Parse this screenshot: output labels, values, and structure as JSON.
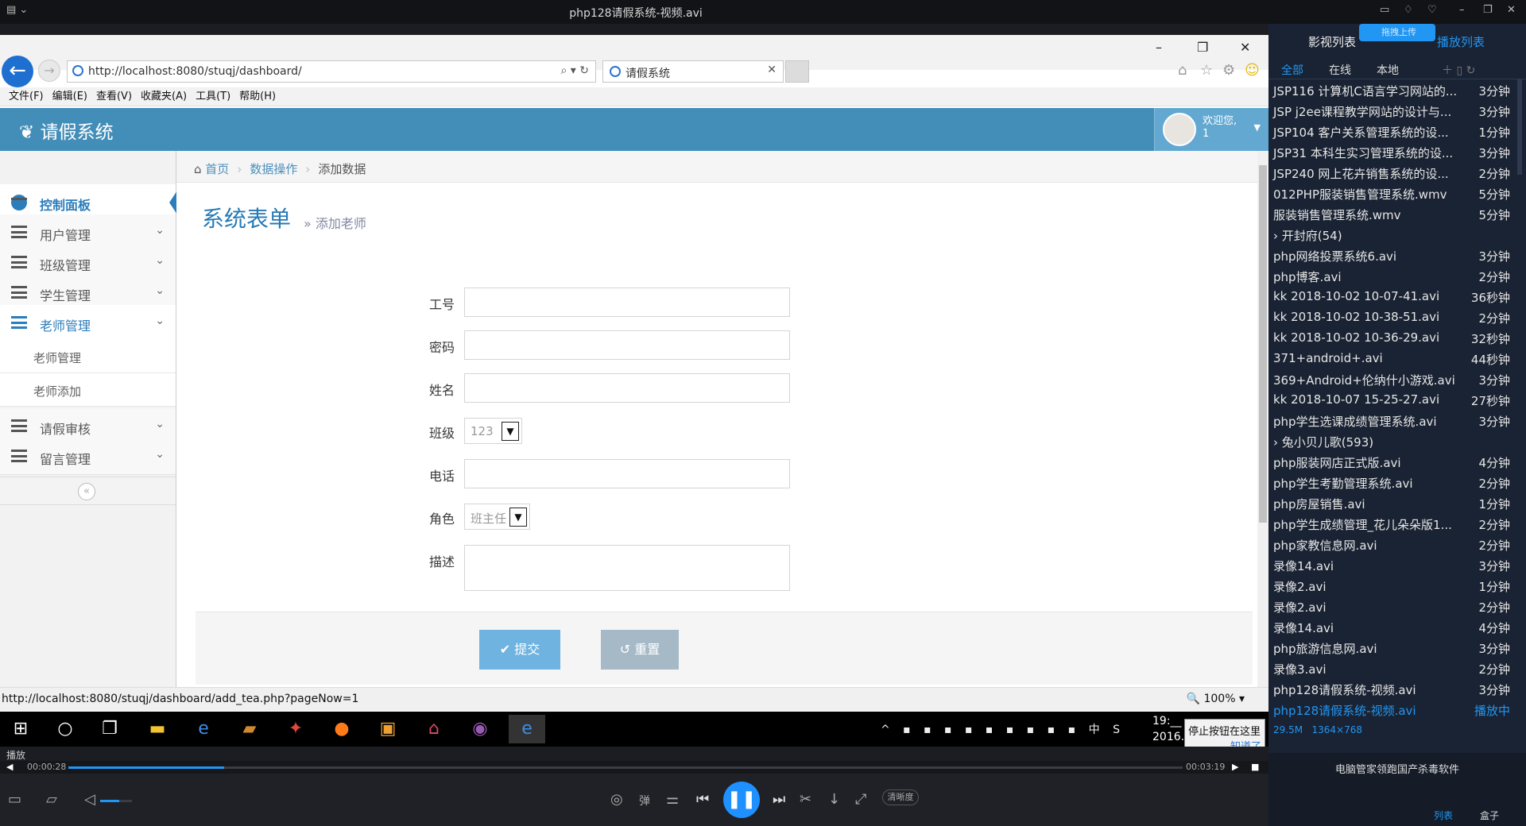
{
  "player": {
    "window_title": "php128请假系统-视频.avi",
    "status_label": "播放",
    "time_current": "00:00:28",
    "time_total": "00:03:19",
    "progress": 0.14,
    "volume": 0.6,
    "quality_label": "清晰度",
    "danmaku_label": "弹"
  },
  "browser": {
    "url": "http://localhost:8080/stuqj/dashboard/",
    "tab_title": "请假系统",
    "menu": [
      "文件(F)",
      "编辑(E)",
      "查看(V)",
      "收藏夹(A)",
      "工具(T)",
      "帮助(H)"
    ],
    "status_url": "http://localhost:8080/stuqj/dashboard/add_tea.php?pageNow=1",
    "zoom": "100%"
  },
  "app": {
    "brand": "请假系统",
    "user_greeting": "欢迎您,",
    "user_name": "1",
    "breadcrumb": {
      "home": "首页",
      "level1": "数据操作",
      "current": "添加数据"
    },
    "sidebar": {
      "dashboard": "控制面板",
      "items": [
        "用户管理",
        "班级管理",
        "学生管理",
        "老师管理",
        "请假审核",
        "留言管理"
      ],
      "sub_items": [
        "老师管理",
        "老师添加"
      ]
    },
    "form": {
      "title": "系统表单",
      "subtitle": "» 添加老师",
      "labels": {
        "id": "工号",
        "password": "密码",
        "name": "姓名",
        "class": "班级",
        "phone": "电话",
        "role": "角色",
        "desc": "描述"
      },
      "class_value": "123",
      "role_value": "班主任",
      "submit": "提交",
      "reset": "重置"
    }
  },
  "taskbar": {
    "time": "19:__",
    "date": "2016...",
    "tooltip": "停止按钮在这里",
    "tooltip_link": "知道了",
    "ime": "中"
  },
  "playlist": {
    "title": "影视列表",
    "badge": "拖拽上传",
    "title2": "播放列表",
    "tabs": [
      "全部",
      "在线",
      "本地"
    ],
    "rows": [
      {
        "name": "JSP116 计算机C语言学习网站的...",
        "dur": "3分钟"
      },
      {
        "name": "JSP j2ee课程教学网站的设计与...",
        "dur": "3分钟"
      },
      {
        "name": "JSP104 客户关系管理系统的设...",
        "dur": "1分钟"
      },
      {
        "name": "JSP31 本科生实习管理系统的设...",
        "dur": "3分钟"
      },
      {
        "name": "JSP240 网上花卉销售系统的设...",
        "dur": "2分钟"
      },
      {
        "name": "012PHP服装销售管理系统.wmv",
        "dur": "5分钟"
      },
      {
        "name": "服装销售管理系统.wmv",
        "dur": "5分钟"
      },
      {
        "name": "› 开封府(54)",
        "dur": ""
      },
      {
        "name": "php网络投票系统6.avi",
        "dur": "3分钟"
      },
      {
        "name": "php博客.avi",
        "dur": "2分钟"
      },
      {
        "name": "kk 2018-10-02 10-07-41.avi",
        "dur": "36秒钟"
      },
      {
        "name": "kk 2018-10-02 10-38-51.avi",
        "dur": "2分钟"
      },
      {
        "name": "kk 2018-10-02 10-36-29.avi",
        "dur": "32秒钟"
      },
      {
        "name": "371+android+.avi",
        "dur": "44秒钟"
      },
      {
        "name": "369+Android+伦纳什小游戏.avi",
        "dur": "3分钟"
      },
      {
        "name": "kk 2018-10-07 15-25-27.avi",
        "dur": "27秒钟"
      },
      {
        "name": "php学生选课成绩管理系统.avi",
        "dur": "3分钟"
      },
      {
        "name": "› 兔小贝儿歌(593)",
        "dur": ""
      },
      {
        "name": "php服装网店正式版.avi",
        "dur": "4分钟"
      },
      {
        "name": "php学生考勤管理系统.avi",
        "dur": "2分钟"
      },
      {
        "name": "php房屋销售.avi",
        "dur": "1分钟"
      },
      {
        "name": "php学生成绩管理_花儿朵朵版1...",
        "dur": "2分钟"
      },
      {
        "name": "php家教信息网.avi",
        "dur": "2分钟"
      },
      {
        "name": "录像14.avi",
        "dur": "3分钟"
      },
      {
        "name": "录像2.avi",
        "dur": "1分钟"
      },
      {
        "name": "录像2.avi",
        "dur": "2分钟"
      },
      {
        "name": "录像14.avi",
        "dur": "4分钟"
      },
      {
        "name": "php旅游信息网.avi",
        "dur": "3分钟"
      },
      {
        "name": "录像3.avi",
        "dur": "2分钟"
      },
      {
        "name": "php128请假系统-视频.avi",
        "dur": "3分钟"
      },
      {
        "name": "php128请假系统-视频.avi",
        "dur": "播放中"
      }
    ],
    "info_size": "29.5M",
    "info_res": "1364×768",
    "ad_text": "电脑管家领跑国产杀毒软件",
    "foot_tab1": "列表",
    "foot_tab2": "盒子"
  }
}
